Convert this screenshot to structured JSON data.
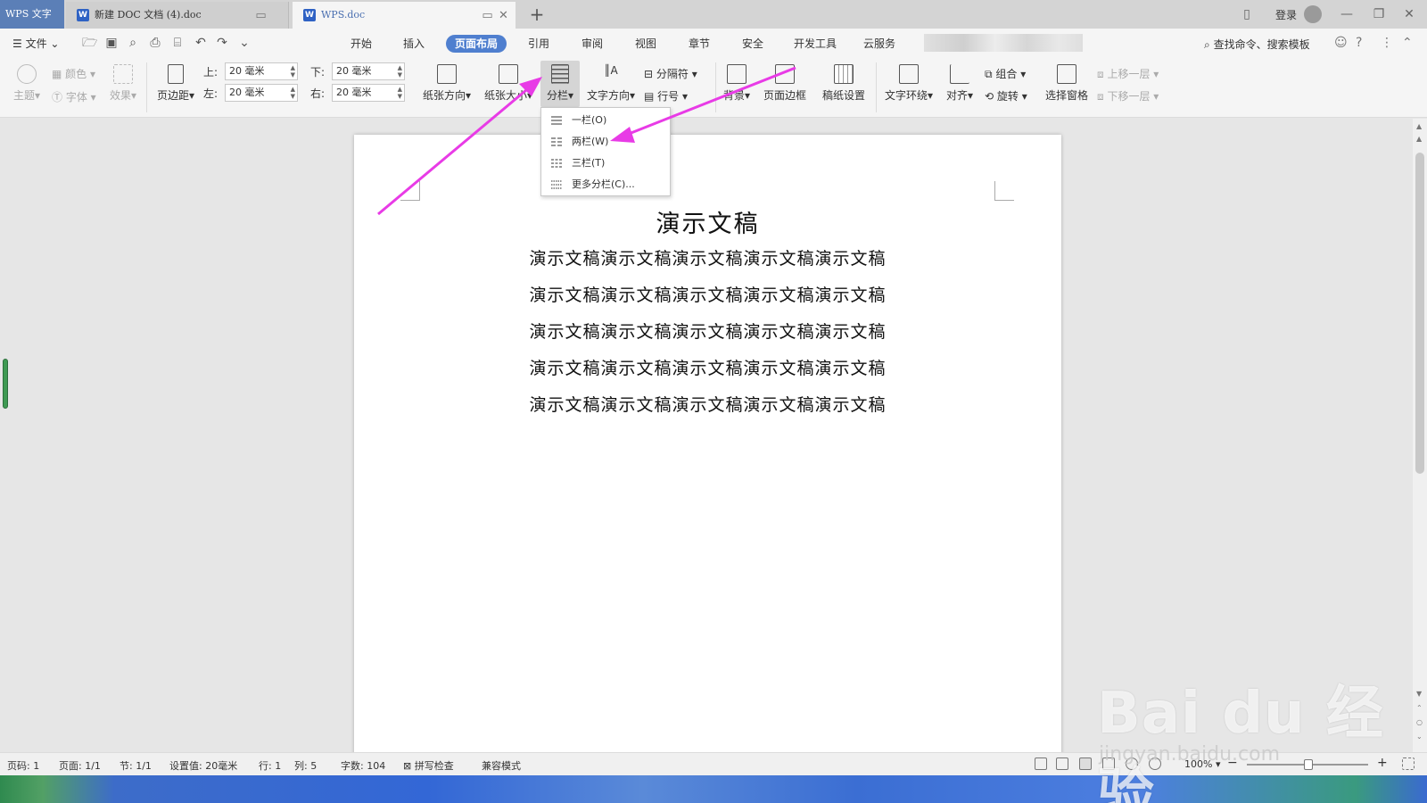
{
  "app": {
    "badge": "WPS 文字",
    "tabs": [
      {
        "label": "新建 DOC 文档 (4).doc",
        "icon": "W",
        "active": false
      },
      {
        "label": "WPS.doc",
        "icon": "W",
        "active": true
      }
    ],
    "new_tab": "+",
    "login": "登录"
  },
  "menu": {
    "file": "文件",
    "tabs": [
      "开始",
      "插入",
      "页面布局",
      "引用",
      "审阅",
      "视图",
      "章节",
      "安全",
      "开发工具",
      "云服务"
    ],
    "active_tab": "页面布局",
    "search": "查找命令、搜索模板"
  },
  "ribbon": {
    "theme": "主题",
    "color": "颜色",
    "font": "字体",
    "effect": "效果",
    "margins": "页边距",
    "margin_top_label": "上:",
    "margin_top": "20 毫米",
    "margin_bottom_label": "下:",
    "margin_bottom": "20 毫米",
    "margin_left_label": "左:",
    "margin_left": "20 毫米",
    "margin_right_label": "右:",
    "margin_right": "20 毫米",
    "orientation": "纸张方向",
    "paper_size": "纸张大小",
    "columns": "分栏",
    "text_direction": "文字方向",
    "separator": "分隔符",
    "line_number": "行号",
    "background": "背景",
    "page_border": "页面边框",
    "manuscript": "稿纸设置",
    "text_wrap": "文字环绕",
    "align": "对齐",
    "group": "组合",
    "rotate": "旋转",
    "selection_pane": "选择窗格",
    "bring_forward": "上移一层",
    "send_backward": "下移一层"
  },
  "columns_menu": {
    "items": [
      "一栏(O)",
      "两栏(W)",
      "三栏(T)",
      "更多分栏(C)..."
    ]
  },
  "document": {
    "title": "演示文稿",
    "lines": [
      "演示文稿演示文稿演示文稿演示文稿演示文稿",
      "演示文稿演示文稿演示文稿演示文稿演示文稿",
      "演示文稿演示文稿演示文稿演示文稿演示文稿",
      "演示文稿演示文稿演示文稿演示文稿演示文稿",
      "演示文稿演示文稿演示文稿演示文稿演示文稿"
    ]
  },
  "status": {
    "page_code": "页码: 1",
    "page": "页面: 1/1",
    "section": "节: 1/1",
    "setting": "设置值: 20毫米",
    "row": "行: 1",
    "col": "列: 5",
    "words": "字数: 104",
    "spell": "拼写检查",
    "compat": "兼容模式",
    "zoom": "100%"
  },
  "watermark": {
    "brand": "Bai du 经验",
    "url": "jingyan.baidu.com"
  },
  "colors": {
    "accent": "#4f7fcf",
    "arrow": "#e83be6",
    "taskbar": "#3367d6"
  }
}
